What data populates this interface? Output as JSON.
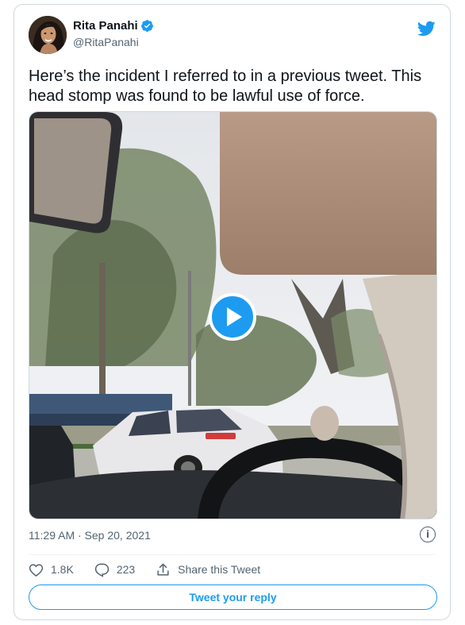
{
  "author": {
    "display_name": "Rita Panahi",
    "handle": "@RitaPanahi",
    "verified": true
  },
  "tweet": {
    "text": "Here’s the incident I referred to in a previous tweet. This head stomp was found to be lawful use of force.",
    "timestamp": "11:29 AM · Sep 20, 2021"
  },
  "media": {
    "type": "video",
    "play_icon": "play-icon"
  },
  "actions": {
    "like_count": "1.8K",
    "reply_count": "223",
    "share_label": "Share this Tweet"
  },
  "reply_button": {
    "label": "Tweet your reply"
  },
  "colors": {
    "accent": "#1d9bf0",
    "text_primary": "#0f1419",
    "text_secondary": "#536471",
    "border": "#cfd9de"
  }
}
